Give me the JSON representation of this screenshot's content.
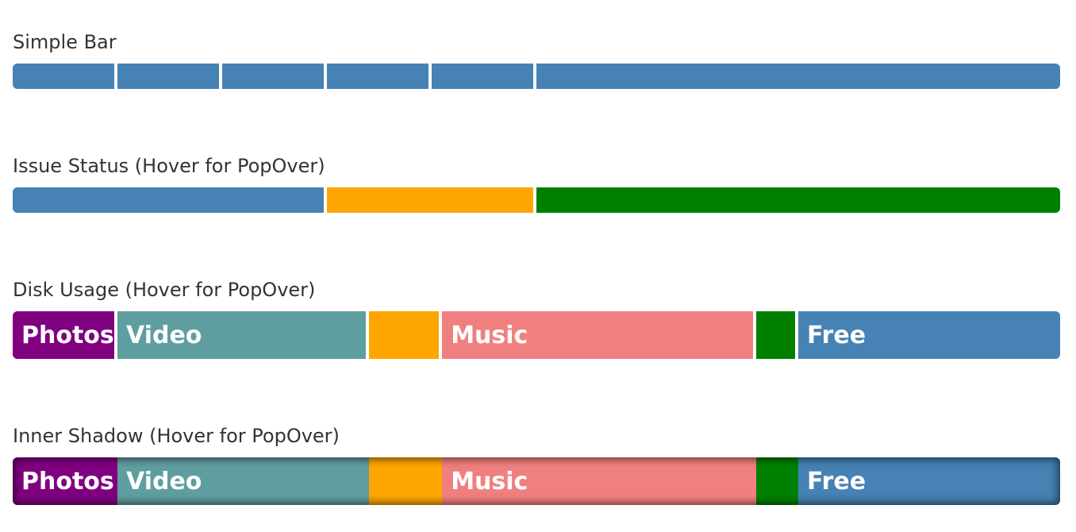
{
  "sections": [
    {
      "title": "Simple Bar",
      "segments": [
        {
          "value": 10,
          "color": "#4682b4",
          "label": ""
        },
        {
          "value": 10,
          "color": "#4682b4",
          "label": ""
        },
        {
          "value": 10,
          "color": "#4682b4",
          "label": ""
        },
        {
          "value": 10,
          "color": "#4682b4",
          "label": ""
        },
        {
          "value": 10,
          "color": "#4682b4",
          "label": ""
        },
        {
          "value": 50,
          "color": "#4682b4",
          "label": ""
        }
      ]
    },
    {
      "title": "Issue Status (Hover for PopOver)",
      "segments": [
        {
          "value": 30,
          "color": "#4682b4",
          "label": ""
        },
        {
          "value": 20,
          "color": "#ffa500",
          "label": ""
        },
        {
          "value": 50,
          "color": "#008000",
          "label": ""
        }
      ]
    },
    {
      "title": "Disk Usage (Hover for PopOver)",
      "segments": [
        {
          "value": 10,
          "color": "#800080",
          "label": "Photos"
        },
        {
          "value": 24,
          "color": "#5f9ea0",
          "label": "Video"
        },
        {
          "value": 7,
          "color": "#ffa500",
          "label": ""
        },
        {
          "value": 30,
          "color": "#f08080",
          "label": "Music"
        },
        {
          "value": 4,
          "color": "#008000",
          "label": ""
        },
        {
          "value": 25,
          "color": "#4682b4",
          "label": "Free"
        }
      ]
    },
    {
      "title": "Inner Shadow (Hover for PopOver)",
      "segments": [
        {
          "value": 10,
          "color": "#800080",
          "label": "Photos"
        },
        {
          "value": 24,
          "color": "#5f9ea0",
          "label": "Video"
        },
        {
          "value": 7,
          "color": "#ffa500",
          "label": ""
        },
        {
          "value": 30,
          "color": "#f08080",
          "label": "Music"
        },
        {
          "value": 4,
          "color": "#008000",
          "label": ""
        },
        {
          "value": 25,
          "color": "#4682b4",
          "label": "Free"
        }
      ]
    }
  ]
}
